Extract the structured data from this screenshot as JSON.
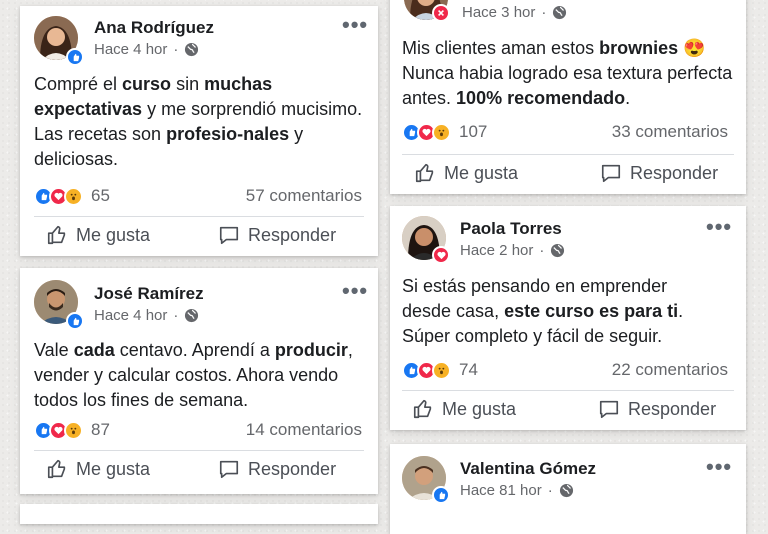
{
  "colors": {
    "facebook_blue": "#1877f2",
    "love_red": "#f0284a",
    "meta_gray": "#65676b"
  },
  "posts": [
    {
      "name": "Ana Rodríguez",
      "time": "Hace 4 hor",
      "avatar_icon": "woman-avatar",
      "badge_icon": "like-badge",
      "segments": [
        {
          "t": "Compré el ",
          "b": false
        },
        {
          "t": "curso",
          "b": true
        },
        {
          "t": " sin ",
          "b": false
        },
        {
          "t": "muchas",
          "b": true
        },
        {
          "t": " ",
          "b": false
        },
        {
          "t": "expectativas",
          "b": true
        },
        {
          "t": " y me sorprendió mucisimo. Las recetas son ",
          "b": false
        },
        {
          "t": "profesio-nales",
          "b": true
        },
        {
          "t": " y deliciosas.",
          "b": false
        }
      ],
      "reactions_count": "65",
      "comments": "57 comentarios",
      "like_label": "Me gusta",
      "reply_label": "Responder"
    },
    {
      "name": "José Ramírez",
      "time": "Hace 4 hor",
      "avatar_icon": "man-avatar",
      "badge_icon": "like-badge",
      "segments": [
        {
          "t": "Vale ",
          "b": false
        },
        {
          "t": "cada",
          "b": true
        },
        {
          "t": " centavo. Aprendí a ",
          "b": false
        },
        {
          "t": "producir",
          "b": true
        },
        {
          "t": ", vender y calcular costos. Ahora vendo todos los fines de semana.",
          "b": false
        }
      ],
      "reactions_count": "87",
      "comments": "14 comentarios",
      "like_label": "Me gusta",
      "reply_label": "Responder"
    },
    {
      "name": "",
      "time": "Hace 3 hor",
      "avatar_icon": "woman-avatar",
      "badge_icon": "angry-badge",
      "segments": [
        {
          "t": "Mis clientes aman estos ",
          "b": false
        },
        {
          "t": "brownies",
          "b": true
        },
        {
          "t": " 😍 Nunca habia logrado esa textura perfecta antes. ",
          "b": false
        },
        {
          "t": "100% recomendado",
          "b": true
        },
        {
          "t": ".",
          "b": false
        }
      ],
      "reactions_count": "107",
      "comments": "33 comentarios",
      "like_label": "Me gusta",
      "reply_label": "Responder"
    },
    {
      "name": "Paola Torres",
      "time": "Hace 2 hor",
      "avatar_icon": "woman-avatar",
      "badge_icon": "love-badge",
      "segments": [
        {
          "t": "Si estás pensando en emprender desde casa, ",
          "b": false
        },
        {
          "t": "este curso es para ti",
          "b": true
        },
        {
          "t": ". Súper completo y fácil de seguir.",
          "b": false
        }
      ],
      "reactions_count": "74",
      "comments": "22 comentarios",
      "like_label": "Me gusta",
      "reply_label": "Responder"
    },
    {
      "name": "Valentina Gómez",
      "time": "Hace 81 hor",
      "avatar_icon": "man-avatar",
      "badge_icon": "like-badge",
      "segments": [],
      "reactions_count": "",
      "comments": "",
      "like_label": "",
      "reply_label": ""
    }
  ]
}
